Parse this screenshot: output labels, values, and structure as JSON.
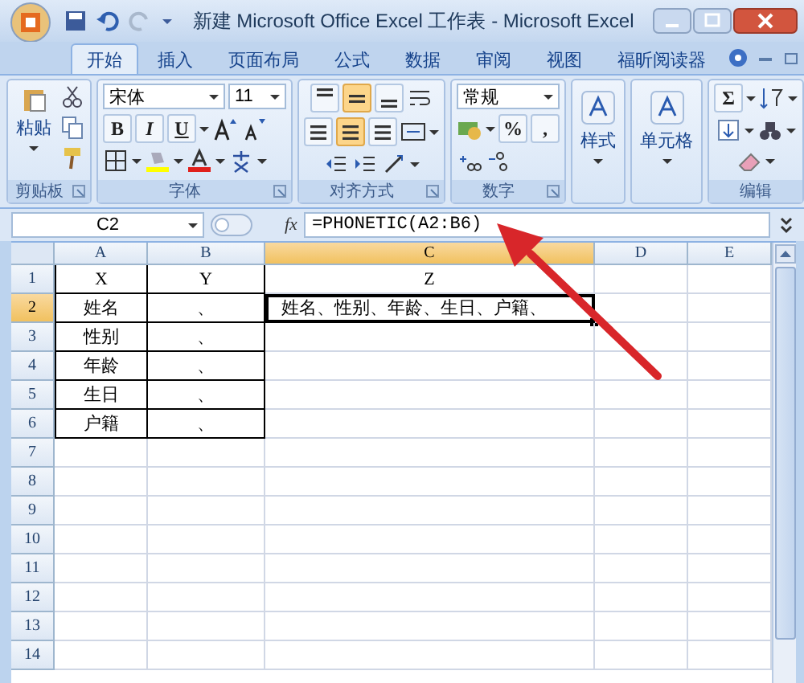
{
  "window": {
    "title": "新建 Microsoft Office Excel 工作表 - Microsoft Excel"
  },
  "tabs": [
    {
      "label": "开始",
      "selected": true
    },
    {
      "label": "插入",
      "selected": false
    },
    {
      "label": "页面布局",
      "selected": false
    },
    {
      "label": "公式",
      "selected": false
    },
    {
      "label": "数据",
      "selected": false
    },
    {
      "label": "审阅",
      "selected": false
    },
    {
      "label": "视图",
      "selected": false
    },
    {
      "label": "福昕阅读器",
      "selected": false
    }
  ],
  "ribbon": {
    "groups": [
      {
        "kind": "clipboard",
        "label": "剪贴板",
        "button_label": "粘贴"
      },
      {
        "kind": "font",
        "label": "字体",
        "font_name": "宋体",
        "font_size": "11",
        "bold": "B",
        "italic": "I",
        "underline": "U"
      },
      {
        "kind": "alignment",
        "label": "对齐方式",
        "align_buttons": [
          {
            "selected": false
          },
          {
            "selected": true
          },
          {
            "selected": false
          },
          {
            "selected": false
          },
          {
            "selected": true
          },
          {
            "selected": false
          }
        ]
      },
      {
        "kind": "number",
        "label": "数字",
        "format": "常规",
        "percent": "%",
        "comma": ","
      },
      {
        "kind": "big",
        "button_label": "样式"
      },
      {
        "kind": "big",
        "button_label": "单元格"
      },
      {
        "kind": "editing",
        "label": "编辑",
        "sum": "Σ"
      }
    ]
  },
  "formula_bar": {
    "name_box": "C2",
    "fx": "fx",
    "formula": "=PHONETIC(A2:B6)"
  },
  "sheet": {
    "columns": [
      {
        "label": "A",
        "selected": false,
        "bordered": true
      },
      {
        "label": "B",
        "selected": false,
        "bordered": true
      },
      {
        "label": "C",
        "selected": true,
        "bordered": false
      },
      {
        "label": "D",
        "selected": false,
        "bordered": false
      },
      {
        "label": "E",
        "selected": false,
        "bordered": false
      }
    ],
    "rows": [
      {
        "number": "1",
        "selected": false,
        "bordered": true,
        "cells": [
          "X",
          "Y",
          "Z",
          "",
          ""
        ]
      },
      {
        "number": "2",
        "selected": true,
        "bordered": true,
        "cells": [
          "姓名",
          "、",
          "姓名、性别、年龄、生日、户籍、",
          "",
          ""
        ]
      },
      {
        "number": "3",
        "selected": false,
        "bordered": true,
        "cells": [
          "性别",
          "、",
          "",
          "",
          ""
        ]
      },
      {
        "number": "4",
        "selected": false,
        "bordered": true,
        "cells": [
          "年龄",
          "、",
          "",
          "",
          ""
        ]
      },
      {
        "number": "5",
        "selected": false,
        "bordered": true,
        "cells": [
          "生日",
          "、",
          "",
          "",
          ""
        ]
      },
      {
        "number": "6",
        "selected": false,
        "bordered": true,
        "cells": [
          "户籍",
          "、",
          "",
          "",
          ""
        ]
      },
      {
        "number": "7",
        "selected": false,
        "bordered": false,
        "cells": [
          "",
          "",
          "",
          "",
          ""
        ]
      },
      {
        "number": "8",
        "selected": false,
        "bordered": false,
        "cells": [
          "",
          "",
          "",
          "",
          ""
        ]
      },
      {
        "number": "9",
        "selected": false,
        "bordered": false,
        "cells": [
          "",
          "",
          "",
          "",
          ""
        ]
      },
      {
        "number": "10",
        "selected": false,
        "bordered": false,
        "cells": [
          "",
          "",
          "",
          "",
          ""
        ]
      },
      {
        "number": "11",
        "selected": false,
        "bordered": false,
        "cells": [
          "",
          "",
          "",
          "",
          ""
        ]
      },
      {
        "number": "12",
        "selected": false,
        "bordered": false,
        "cells": [
          "",
          "",
          "",
          "",
          ""
        ]
      },
      {
        "number": "13",
        "selected": false,
        "bordered": false,
        "cells": [
          "",
          "",
          "",
          "",
          ""
        ]
      },
      {
        "number": "14",
        "selected": false,
        "bordered": false,
        "cells": [
          "",
          "",
          "",
          "",
          ""
        ]
      }
    ]
  }
}
